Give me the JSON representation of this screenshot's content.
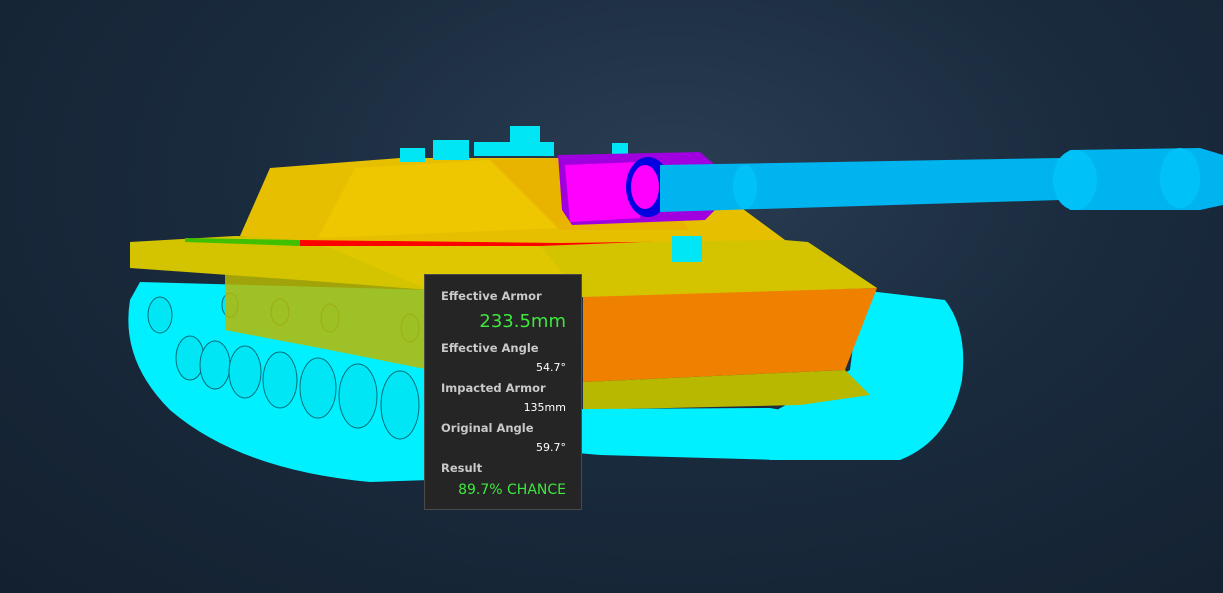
{
  "scene": {
    "background_color": "#16263a",
    "colors": {
      "tracks": "#00f0ff",
      "hull_upper": "#d4c400",
      "turret": "#e6c000",
      "weak_zone": "#ff0000",
      "lower_plate": "#f08000",
      "mantlet": "#ff00ff",
      "gun_base": "#0000e0",
      "barrel": "#00b4f0"
    }
  },
  "tooltip": {
    "effective_armor_label": "Effective Armor",
    "effective_armor_value": "233.5mm",
    "effective_angle_label": "Effective Angle",
    "effective_angle_value": "54.7°",
    "impacted_armor_label": "Impacted Armor",
    "impacted_armor_value": "135mm",
    "original_angle_label": "Original Angle",
    "original_angle_value": "59.7°",
    "result_label": "Result",
    "result_value": "89.7% CHANCE"
  }
}
